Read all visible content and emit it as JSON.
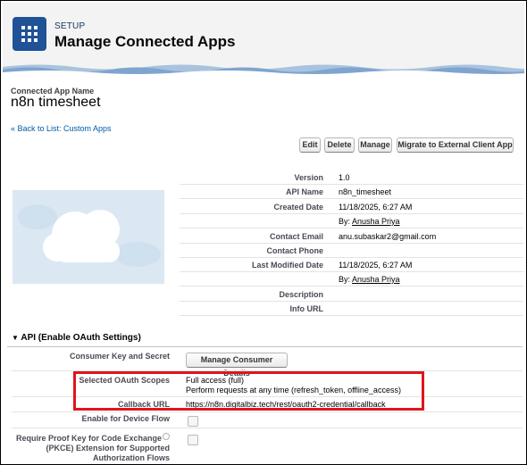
{
  "header": {
    "setup_label": "SETUP",
    "title": "Manage Connected Apps",
    "icon": "app-grid-icon",
    "icon_color": "#1f5297"
  },
  "record": {
    "label": "Connected App Name",
    "name": "n8n timesheet",
    "back_link": "« Back to List: Custom Apps"
  },
  "buttons": {
    "edit": "Edit",
    "delete": "Delete",
    "manage": "Manage",
    "migrate": "Migrate to External Client App"
  },
  "details": {
    "version_label": "Version",
    "version": "1.0",
    "api_name_label": "API Name",
    "api_name": "n8n_timesheet",
    "created_date_label": "Created Date",
    "created_date": "11/18/2025, 6:27 AM",
    "created_by_prefix": "By:",
    "created_by": "Anusha Priya",
    "contact_email_label": "Contact Email",
    "contact_email": "anu.subaskar2@gmail.com",
    "contact_phone_label": "Contact Phone",
    "modified_date_label": "Last Modified Date",
    "modified_date": "11/18/2025, 6:27 AM",
    "modified_by_prefix": "By:",
    "modified_by": "Anusha Priya",
    "description_label": "Description",
    "info_url_label": "Info URL"
  },
  "oauth": {
    "section_title": "API (Enable OAuth Settings)",
    "consumer_label": "Consumer Key and Secret",
    "consumer_button": "Manage Consumer Details",
    "scopes_label": "Selected OAuth Scopes",
    "scope_1": "Full access (full)",
    "scope_2": "Perform requests at any time (refresh_token, offline_access)",
    "callback_label": "Callback URL",
    "callback_url": "https://n8n.digitalbiz.tech/rest/oauth2-credential/callback",
    "device_flow_label": "Enable for Device Flow",
    "pkce_label_1": "Require Proof Key for Code Exchange",
    "pkce_label_2": "(PKCE) Extension for Supported",
    "pkce_label_3": "Authorization Flows",
    "highlight_color": "#e0141e"
  }
}
